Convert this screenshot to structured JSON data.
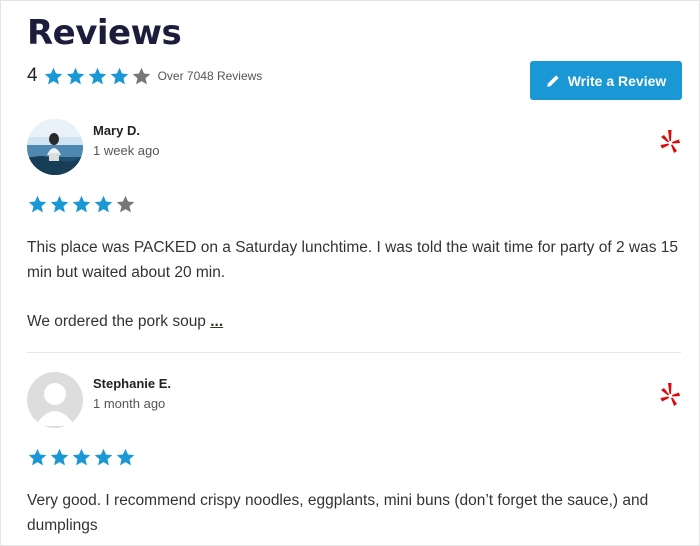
{
  "header": {
    "title": "Reviews",
    "rating_value": "4",
    "rating_stars": 4,
    "review_count_label": "Over 7048 Reviews",
    "write_button_label": "Write a Review"
  },
  "colors": {
    "star_filled": "#1a98d5",
    "star_empty": "#777777",
    "button_bg": "#1a98d5",
    "yelp_red": "#e00707"
  },
  "reviews": [
    {
      "author": "Mary D.",
      "date": "1 week ago",
      "stars": 4,
      "source_icon": "yelp-icon",
      "text_lines": [
        "This place was PACKED on a Saturday lunchtime. I was told the wait time for party of 2 was 15 min but waited about 20 min.",
        "We ordered the pork soup"
      ],
      "more_link": "..."
    },
    {
      "author": "Stephanie E.",
      "date": "1 month ago",
      "stars": 5,
      "source_icon": "yelp-icon",
      "text_lines": [
        "Very good. I recommend crispy noodles, eggplants, mini buns (don’t forget the sauce,) and dumplings"
      ]
    }
  ]
}
